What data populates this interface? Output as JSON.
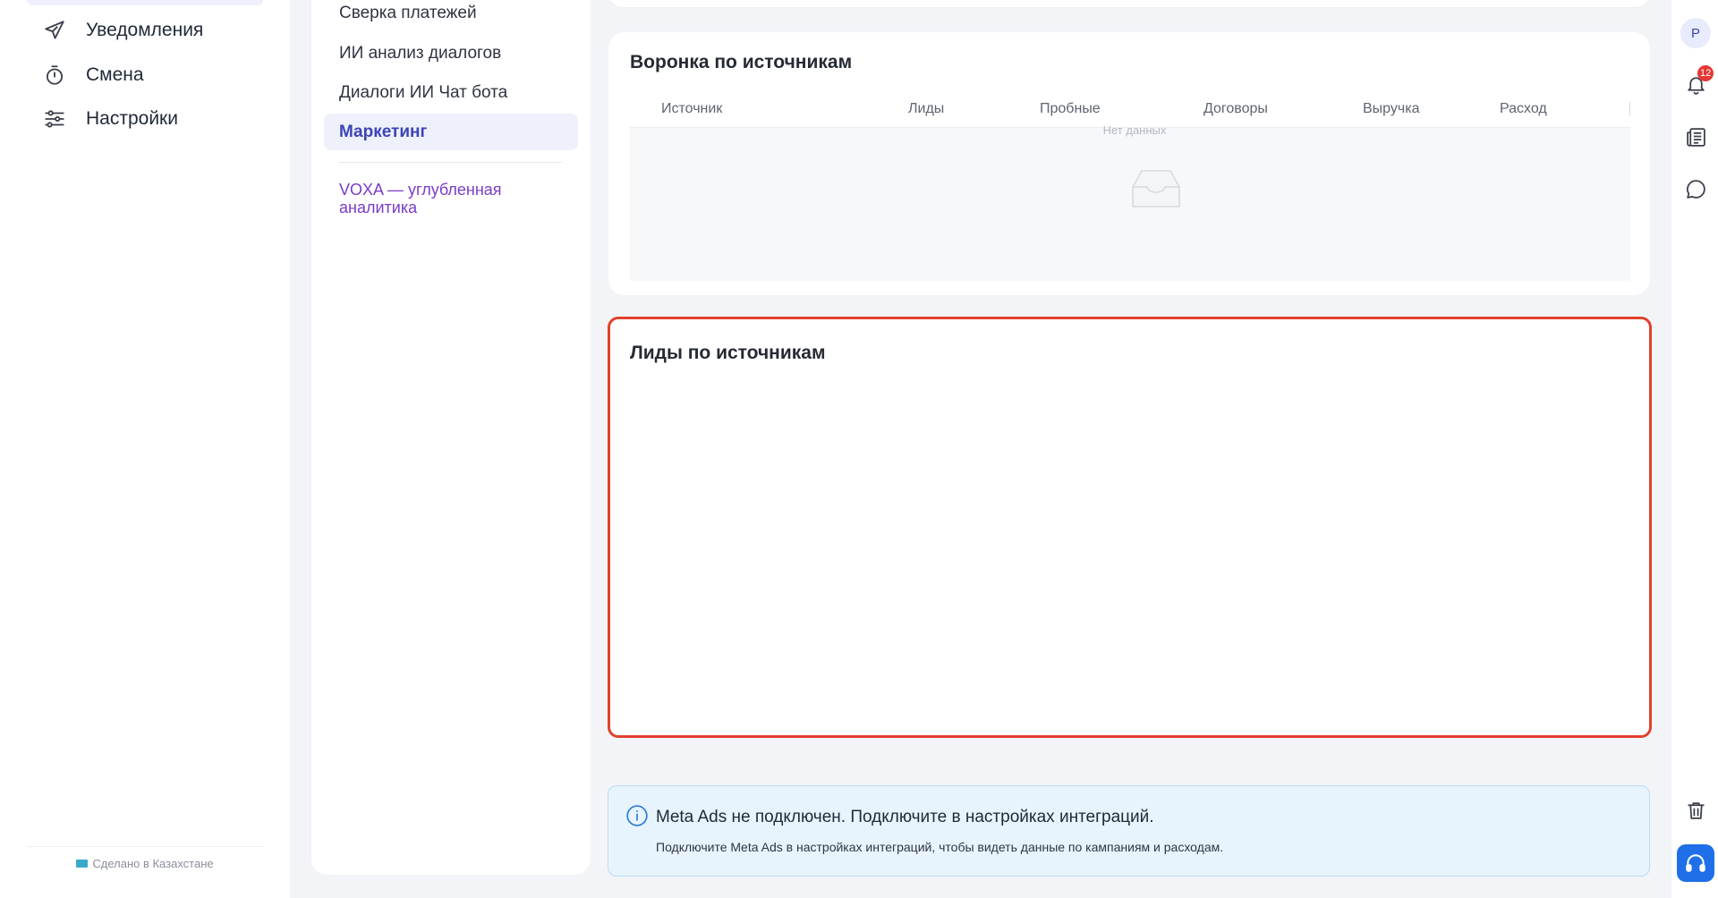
{
  "sidebar": {
    "items": [
      {
        "label": "Уведомления",
        "icon": "send-icon"
      },
      {
        "label": "Смена",
        "icon": "timer-icon"
      },
      {
        "label": "Настройки",
        "icon": "sliders-icon"
      }
    ],
    "footer": "Сделано в Казахстане"
  },
  "submenu": {
    "items": [
      {
        "label": "Сверка платежей"
      },
      {
        "label": "ИИ анализ диалогов"
      },
      {
        "label": "Диалоги ИИ Чат бота"
      },
      {
        "label": "Маркетинг",
        "active": true
      }
    ],
    "voxa_link": "VOXA — углубленная аналитика"
  },
  "funnel": {
    "title": "Воронка по источникам",
    "columns": [
      "Источник",
      "Лиды",
      "Пробные",
      "Договоры",
      "Выручка",
      "Расход"
    ],
    "empty_text": "Нет данных"
  },
  "leads": {
    "title": "Лиды по источникам"
  },
  "alert": {
    "title": "Meta Ads не подключен. Подключите в настройках интеграций.",
    "description": "Подключите Meta Ads в настройках интеграций, чтобы видеть данные по кампаниям и расходам."
  },
  "rail": {
    "avatar_initial": "P",
    "notification_count": "12"
  },
  "colors": {
    "accent": "#1e6fe8",
    "active_text": "#3b44b5",
    "voxa": "#7a3cc9",
    "highlight_border": "#e0412c",
    "badge": "#e53935"
  }
}
